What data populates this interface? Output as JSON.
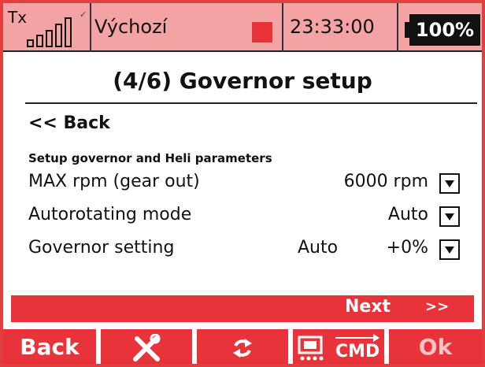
{
  "status_bar": {
    "tx_label": "Tx",
    "signal_bars": 5,
    "signal_icon": "signal-strength-icon",
    "model_name": "Výchozí",
    "record_icon": "record-indicator-icon",
    "record_color": "#e8333a",
    "time": "23:33:00",
    "battery": "100%",
    "battery_icon": "battery-icon"
  },
  "page": {
    "title": "(4/6) Governor setup",
    "back_link": "<< Back",
    "section_label": "Setup governor and Heli parameters"
  },
  "rows": [
    {
      "label": "MAX rpm  (gear out)",
      "value": "6000 rpm"
    },
    {
      "label": "Autorotating mode",
      "value": "Auto"
    },
    {
      "label": "Governor setting",
      "value": "+0%",
      "secondary_value": "Auto"
    }
  ],
  "next_bar": {
    "label": "Next",
    "arrows": ">>"
  },
  "softkeys": {
    "back": "Back",
    "tools_icon": "tools-icon",
    "refresh_icon": "refresh-icon",
    "cmd_icon": "transmitter-cmd-icon",
    "cmd_label": "CMD",
    "ok": "Ok"
  },
  "colors": {
    "accent": "#e8333a",
    "status_bg": "#f3a3a3",
    "frame": "#e13f3f"
  }
}
